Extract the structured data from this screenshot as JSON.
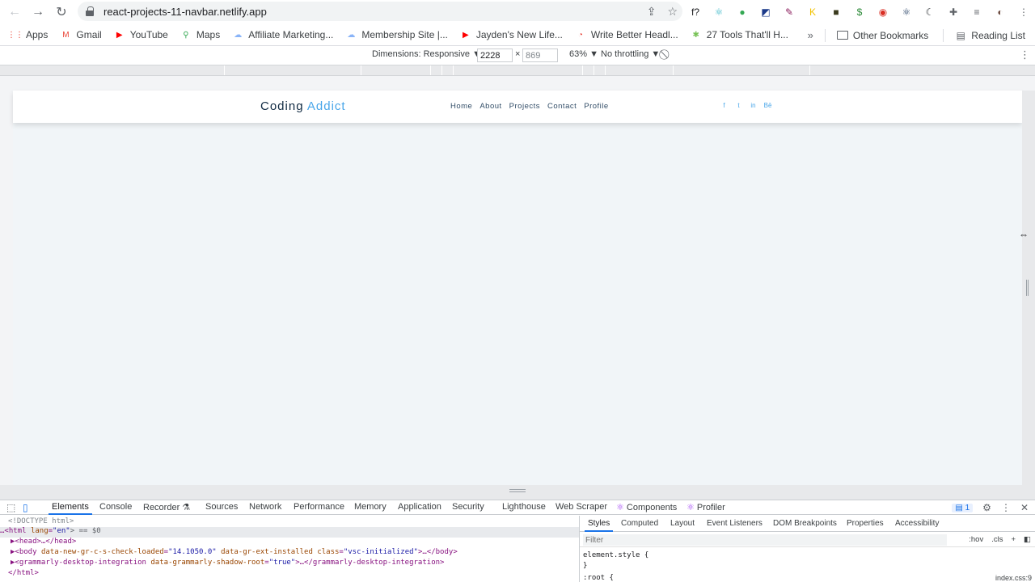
{
  "browser": {
    "url": "react-projects-11-navbar.netlify.app",
    "extensions": [
      {
        "icon": "font-ext-icon",
        "glyph": "f?",
        "color": "#202124"
      },
      {
        "icon": "atom-ext-icon",
        "glyph": "⚛",
        "color": "#3ab7c7"
      },
      {
        "icon": "color-wheel-ext-icon",
        "glyph": "●",
        "color": "#34a853"
      },
      {
        "icon": "screen-ext-icon",
        "glyph": "◩",
        "color": "#1d3b8a"
      },
      {
        "icon": "grammar-ext-icon",
        "glyph": "✎",
        "color": "#8a1c5c"
      },
      {
        "icon": "k-ext-icon",
        "glyph": "K",
        "color": "#f2c200"
      },
      {
        "icon": "square-ext-icon",
        "glyph": "■",
        "color": "#3b3b1e"
      },
      {
        "icon": "dollar-ext-icon",
        "glyph": "$",
        "color": "#2e8b3a"
      },
      {
        "icon": "tomato-ext-icon",
        "glyph": "◉",
        "color": "#d93025"
      },
      {
        "icon": "react-devtools-ext-icon",
        "glyph": "⚛",
        "color": "#1e3a5f"
      },
      {
        "icon": "moon-ext-icon",
        "glyph": "☾",
        "color": "#3c4043"
      },
      {
        "icon": "puzzle-ext-icon",
        "glyph": "✚",
        "color": "#5f6368"
      },
      {
        "icon": "reading-list-ext-icon",
        "glyph": "≡",
        "color": "#5f6368"
      },
      {
        "icon": "profile-avatar-icon",
        "glyph": "◐",
        "color": "#6d4c41"
      },
      {
        "icon": "more-menu-icon",
        "glyph": "⋮",
        "color": "#5f6368"
      }
    ]
  },
  "bookmarks": {
    "items": [
      {
        "label": "Apps",
        "icon": "apps-grid-icon",
        "color": "#ea4335",
        "glyph": "⋮⋮"
      },
      {
        "label": "Gmail",
        "icon": "gmail-icon",
        "color": "#ea4335",
        "glyph": "M"
      },
      {
        "label": "YouTube",
        "icon": "youtube-icon",
        "color": "#ff0000",
        "glyph": "▶"
      },
      {
        "label": "Maps",
        "icon": "maps-pin-icon",
        "color": "#34a853",
        "glyph": "⚲"
      },
      {
        "label": "Affiliate Marketing...",
        "icon": "cloud-icon",
        "color": "#8ab4f8",
        "glyph": "☁"
      },
      {
        "label": "Membership Site |...",
        "icon": "cloud-icon",
        "color": "#8ab4f8",
        "glyph": "☁"
      },
      {
        "label": "Jayden's New Life...",
        "icon": "youtube-icon",
        "color": "#ff0000",
        "glyph": "▶"
      },
      {
        "label": "Write Better Headl...",
        "icon": "coschedule-icon",
        "color": "#e8453c",
        "glyph": "◔"
      },
      {
        "label": "27 Tools That'll H...",
        "icon": "android-icon",
        "color": "#78c257",
        "glyph": "✱"
      }
    ],
    "overflow": "»",
    "other": "Other Bookmarks",
    "reading_list": "Reading List"
  },
  "device_toolbar": {
    "dimensions_label": "Dimensions: Responsive ▼",
    "width": "2228",
    "times": "×",
    "height": "869",
    "zoom": "63% ▼",
    "throttling": "No throttling ▼"
  },
  "site": {
    "logo_main": "Coding",
    "logo_accent": "Addict",
    "links": [
      "Home",
      "About",
      "Projects",
      "Contact",
      "Profile"
    ],
    "social": [
      {
        "icon": "facebook-icon",
        "glyph": "f"
      },
      {
        "icon": "twitter-icon",
        "glyph": "t"
      },
      {
        "icon": "linkedin-icon",
        "glyph": "in"
      },
      {
        "icon": "behance-icon",
        "glyph": "Bē"
      }
    ],
    "accent_color": "#49a6e9"
  },
  "devtools": {
    "tabs": [
      "Elements",
      "Console",
      "Recorder ⚗",
      "Sources",
      "Network",
      "Performance",
      "Memory",
      "Application",
      "Security",
      "Lighthouse",
      "Web Scraper",
      "Components",
      "Profiler"
    ],
    "issues_count": "1",
    "dom": {
      "doctype": "<!DOCTYPE html>",
      "html_open_prefix": "…<html ",
      "html_attr": "lang",
      "html_val": "\"en\"",
      "html_suffix": "> == $0",
      "head": "▶<head>…</head>",
      "body_prefix": "▶<body ",
      "body_attr1": "data-new-gr-c-s-check-loaded",
      "body_val1": "\"14.1050.0\"",
      "body_attr2": "data-gr-ext-installed",
      "body_attr3": "class",
      "body_val3": "\"vsc-initialized\"",
      "body_suffix": ">…</body>",
      "grammarly_prefix": "▶<grammarly-desktop-integration ",
      "grammarly_attr": "data-grammarly-shadow-root",
      "grammarly_val": "\"true\"",
      "grammarly_suffix": ">…</grammarly-desktop-integration>",
      "html_close": "</html>"
    },
    "styles_tabs": [
      "Styles",
      "Computed",
      "Layout",
      "Event Listeners",
      "DOM Breakpoints",
      "Properties",
      "Accessibility"
    ],
    "filter_placeholder": "Filter",
    "filter_hov": ":hov",
    "filter_cls": ".cls",
    "filter_plus": "+",
    "element_style": "element.style {",
    "element_close": "}",
    "root_rule": ":root {",
    "root_source": "index.css:9"
  }
}
